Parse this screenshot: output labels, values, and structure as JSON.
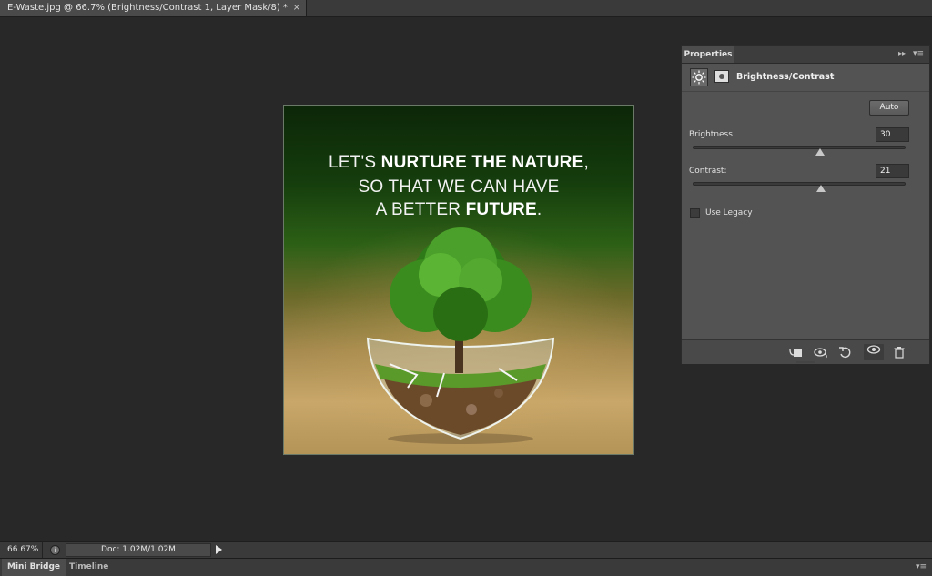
{
  "document_tab": {
    "title": "E-Waste.jpg @ 66.7% (Brightness/Contrast 1, Layer Mask/8) *",
    "close": "×"
  },
  "canvas": {
    "line1_a": "LET'S ",
    "line1_b": "NURTURE THE NATURE",
    "line1_c": ",",
    "line2": "SO THAT WE CAN HAVE",
    "line3_a": "A BETTER ",
    "line3_b": "FUTURE",
    "line3_c": "."
  },
  "properties_panel": {
    "tab_label": "Properties",
    "collapse_icon": "▸▸",
    "menu_icon": "▾≡",
    "adjustment_title": "Brightness/Contrast",
    "auto_label": "Auto",
    "brightness": {
      "label": "Brightness:",
      "value": "30"
    },
    "contrast": {
      "label": "Contrast:",
      "value": "21"
    },
    "use_legacy": {
      "label": "Use Legacy",
      "checked": false
    }
  },
  "status_bar": {
    "zoom": "66.67%",
    "doc_info": "Doc: 1.02M/1.02M"
  },
  "bottom_tabs": {
    "mini_bridge": "Mini Bridge",
    "timeline": "Timeline",
    "menu_icon": "▾≡"
  },
  "icons": {
    "adjustment": "sun-icon",
    "mask": "layer-mask-icon",
    "footer": [
      "clip-to-layer-icon",
      "view-previous-state-icon",
      "reset-icon",
      "visibility-eye-icon",
      "trash-icon"
    ]
  }
}
